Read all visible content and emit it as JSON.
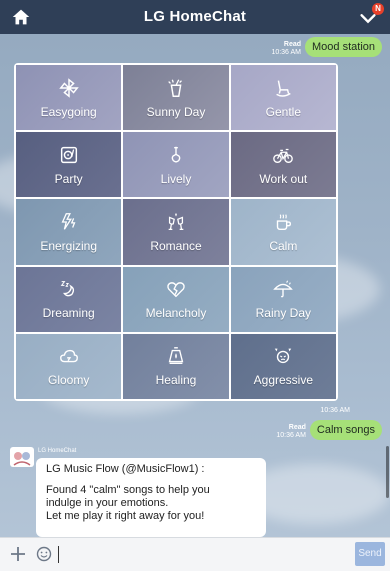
{
  "header": {
    "title": "LG HomeChat",
    "notification_badge": "N"
  },
  "messages": [
    {
      "type": "sent",
      "read_label": "Read",
      "time": "10:36 AM",
      "text": "Mood station"
    },
    {
      "type": "sent",
      "read_label": "Read",
      "time": "10:36 AM",
      "text": "Calm songs"
    }
  ],
  "grid_timestamp": "10:36 AM",
  "mood_grid": [
    {
      "label": "Easygoing",
      "icon": "pinwheel-icon"
    },
    {
      "label": "Sunny Day",
      "icon": "drink-icon"
    },
    {
      "label": "Gentle",
      "icon": "rocking-chair-icon"
    },
    {
      "label": "Party",
      "icon": "turntable-icon"
    },
    {
      "label": "Lively",
      "icon": "guitar-icon"
    },
    {
      "label": "Work out",
      "icon": "bicycle-icon"
    },
    {
      "label": "Energizing",
      "icon": "lightning-icon"
    },
    {
      "label": "Romance",
      "icon": "toast-glasses-icon"
    },
    {
      "label": "Calm",
      "icon": "coffee-cup-icon"
    },
    {
      "label": "Dreaming",
      "icon": "moon-sleep-icon"
    },
    {
      "label": "Melancholy",
      "icon": "broken-heart-icon"
    },
    {
      "label": "Rainy Day",
      "icon": "umbrella-icon"
    },
    {
      "label": "Gloomy",
      "icon": "cloud-icon"
    },
    {
      "label": "Healing",
      "icon": "lamp-icon"
    },
    {
      "label": "Aggressive",
      "icon": "angry-face-icon"
    }
  ],
  "bot_message": {
    "name": "LG HomeChat",
    "sender": "LG Music Flow (@MusicFlow1) :",
    "lines": [
      "Found 4 \"calm\" songs to help you",
      "indulge in your emotions.",
      "Let me play it right away for you!"
    ]
  },
  "input": {
    "placeholder": "",
    "send_label": "Send"
  },
  "colors": {
    "header": "#2f3f57",
    "bubble_green": "#a6e078",
    "send_button": "#9bb6de"
  }
}
